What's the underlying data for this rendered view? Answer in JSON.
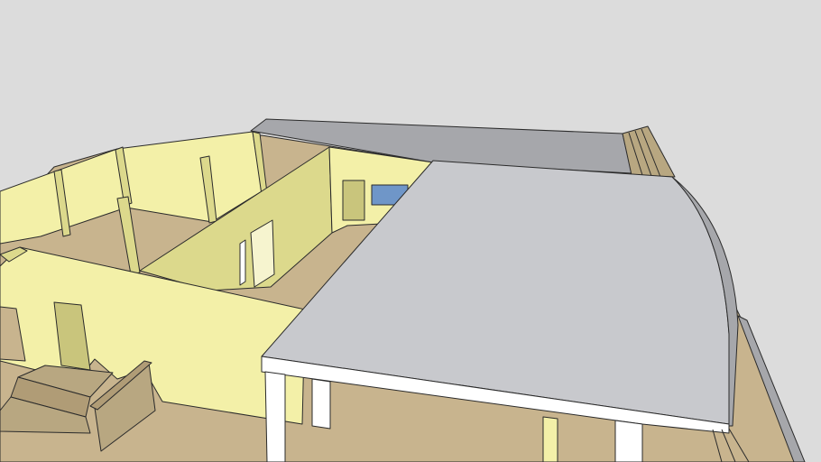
{
  "scene": {
    "description_free": true,
    "colors": {
      "background": "#dcdcdc",
      "wall": "#f3f0a8",
      "wall_shade": "#dcd98c",
      "wall_dark": "#c9c57c",
      "floor": "#c8b48e",
      "floor_dark": "#b09c76",
      "roof_top": "#c8c9cd",
      "roof_side": "#a6a7ab",
      "fascia": "#ffffff",
      "window": "#6f96c8",
      "stone": "#b8a781",
      "edge": "#2b2b2b"
    }
  }
}
